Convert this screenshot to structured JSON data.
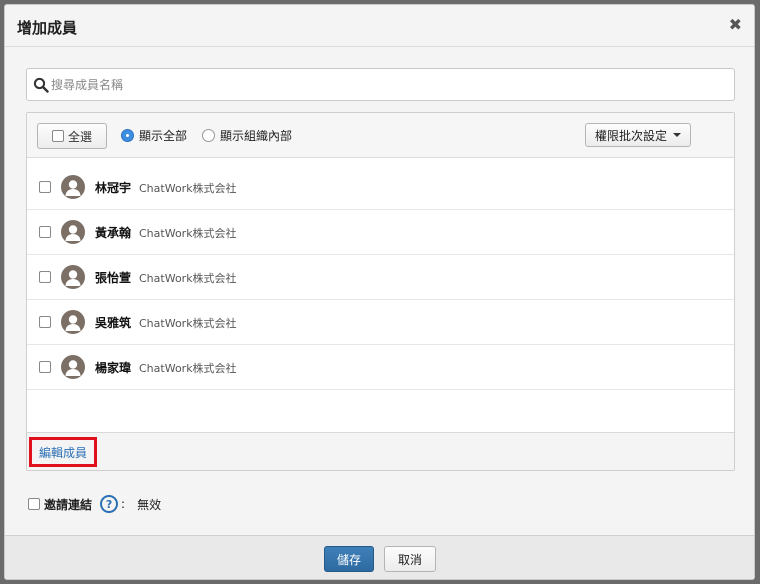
{
  "dialog": {
    "title": "增加成員",
    "close_icon": "close-icon",
    "close_glyph": "✖"
  },
  "search": {
    "placeholder": "搜尋成員名稱",
    "value": "",
    "icon": "search-icon"
  },
  "toolbar": {
    "select_all_label": "全選",
    "radio_all_label": "顯示全部",
    "radio_org_label": "顯示組織內部",
    "selected_radio": "all",
    "permission_button_label": "權限批次設定"
  },
  "members": [
    {
      "name": "林冠宇",
      "org": "ChatWork株式会社",
      "checked": false
    },
    {
      "name": "黃承翰",
      "org": "ChatWork株式会社",
      "checked": false
    },
    {
      "name": "張怡萱",
      "org": "ChatWork株式会社",
      "checked": false
    },
    {
      "name": "吳雅筑",
      "org": "ChatWork株式会社",
      "checked": false
    },
    {
      "name": "楊家瑋",
      "org": "ChatWork株式会社",
      "checked": false
    }
  ],
  "panel_footer": {
    "edit_members_label": "編輯成員"
  },
  "invite": {
    "label": "邀請連結",
    "help_glyph": "?",
    "colon": ":",
    "status": "無效",
    "checked": false
  },
  "footer": {
    "save_label": "儲存",
    "cancel_label": "取消"
  },
  "colors": {
    "primary": "#2d6aa2",
    "link": "#2a6fb4",
    "highlight": "#e0101e",
    "radio_selected": "#3d8ee0"
  }
}
